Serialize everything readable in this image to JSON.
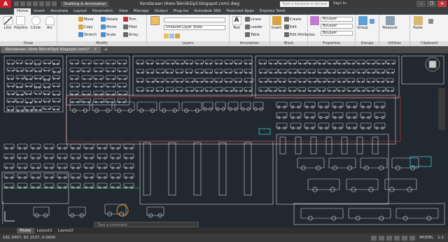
{
  "app": {
    "logo": "A",
    "workspace": "Drafting & Annotation",
    "title": "Kendaraan (Ares-TeknikSipil.blogspot.com).dwg",
    "search_placeholder": "Type a keyword or phrase",
    "signin": "Sign In"
  },
  "ribbon_tabs": [
    "Home",
    "Insert",
    "Annotate",
    "Layout",
    "Parametric",
    "View",
    "Manage",
    "Output",
    "Plug-ins",
    "Autodesk 360",
    "Featured Apps",
    "Express Tools"
  ],
  "ribbon": {
    "draw": {
      "title": "Draw",
      "line": "Line",
      "polyline": "Polyline",
      "circle": "Circle",
      "arc": "Arc"
    },
    "modify": {
      "title": "Modify",
      "move": "Move",
      "copy": "Copy",
      "stretch": "Stretch",
      "rotate": "Rotate",
      "mirror": "Mirror",
      "scale": "Scale",
      "trim": "Trim",
      "fillet": "Fillet",
      "array": "Array"
    },
    "layers": {
      "title": "Layers",
      "layer_properties": "Layer Properties",
      "state": "Unsaved Layer State"
    },
    "annotation": {
      "title": "Annotation",
      "text": "Text",
      "linear": "Linear",
      "leader": "Leader",
      "table": "Table"
    },
    "block": {
      "title": "Block",
      "insert": "Insert",
      "create": "Create",
      "edit": "Edit",
      "edit_attributes": "Edit Attributes"
    },
    "properties": {
      "title": "Properties",
      "match": "Match Properties",
      "bylayer1": "ByLayer",
      "bylayer2": "ByLayer",
      "bylayer3": "ByLayer"
    },
    "groups": {
      "title": "Groups",
      "group": "Group"
    },
    "utilities": {
      "title": "Utilities",
      "measure": "Measure"
    },
    "clipboard": {
      "title": "Clipboard",
      "paste": "Paste"
    }
  },
  "document_tab": "Kendaraan (Ares-TeknikSipil.blogspot.com)*",
  "layout_tabs": [
    "Model",
    "Layout1",
    "Layout2"
  ],
  "command_placeholder": "Type a command",
  "status": {
    "coordinates": "181.3907, 82.1537, 0.0000",
    "model_label": "MODEL",
    "scale": "1:1"
  },
  "colors": {
    "canvas_bg": "#212830",
    "drawing_lines": "#d8d8d8",
    "highlight_red": "#c0303a",
    "highlight_cyan": "#3ac8d8",
    "highlight_orange": "#e08a20",
    "highlight_green": "#2fb04a"
  }
}
